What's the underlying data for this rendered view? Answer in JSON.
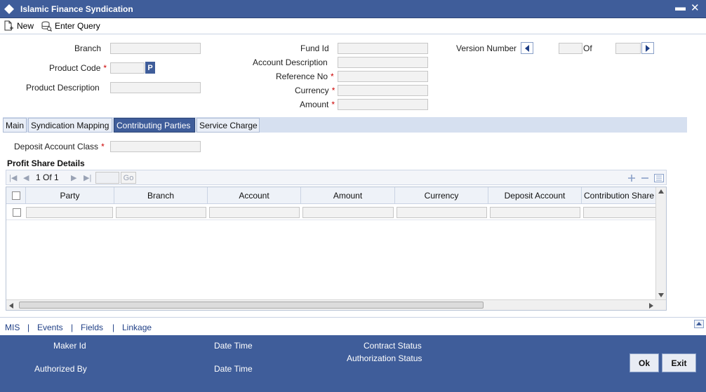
{
  "window": {
    "title": "Islamic Finance Syndication",
    "minimize": "▬",
    "close": "✕"
  },
  "toolbar": {
    "new_label": "New",
    "enter_query_label": "Enter Query"
  },
  "header_fields": {
    "branch": {
      "label": "Branch",
      "value": ""
    },
    "product_code": {
      "label": "Product Code",
      "value": "",
      "required": "*"
    },
    "product_code_lookup": "P",
    "product_description": {
      "label": "Product Description",
      "value": ""
    },
    "fund_id": {
      "label": "Fund Id",
      "value": ""
    },
    "account_description": {
      "label": "Account Description",
      "value": ""
    },
    "reference_no": {
      "label": "Reference No",
      "value": "",
      "required": "*"
    },
    "currency": {
      "label": "Currency",
      "value": "",
      "required": "*"
    },
    "amount": {
      "label": "Amount",
      "value": "",
      "required": "*"
    },
    "version_number": {
      "label": "Version Number",
      "value": "",
      "of_label": "Of",
      "of_value": ""
    }
  },
  "tabs": [
    {
      "label": "Main"
    },
    {
      "label": "Syndication Mapping"
    },
    {
      "label": "Contributing Parties"
    },
    {
      "label": "Service Charge"
    }
  ],
  "active_tab": "Contributing Parties",
  "contributing": {
    "deposit_account_class": {
      "label": "Deposit Account Class",
      "value": "",
      "required": "*"
    },
    "section_title": "Profit Share Details",
    "pager": {
      "page": "1",
      "of": "Of",
      "total": "1",
      "go_label": "Go"
    },
    "columns": [
      "Party",
      "Branch",
      "Account",
      "Amount",
      "Currency",
      "Deposit Account",
      "Contribution Share"
    ],
    "rows": [
      {
        "party": "",
        "branch": "",
        "account": "",
        "amount": "",
        "currency": "",
        "deposit_account": "",
        "contribution_share": ""
      }
    ]
  },
  "links": [
    "MIS",
    "Events",
    "Fields",
    "Linkage"
  ],
  "link_separator": "|",
  "audit": {
    "maker_id": "Maker Id",
    "date_time_1": "Date Time",
    "contract_status": "Contract Status",
    "authorized_by": "Authorized By",
    "date_time_2": "Date Time",
    "authorization_status": "Authorization Status"
  },
  "buttons": {
    "ok": "Ok",
    "exit": "Exit"
  },
  "colors": {
    "brand": "#3f5d9a",
    "required": "#cc0000",
    "link": "#1f3f86"
  }
}
